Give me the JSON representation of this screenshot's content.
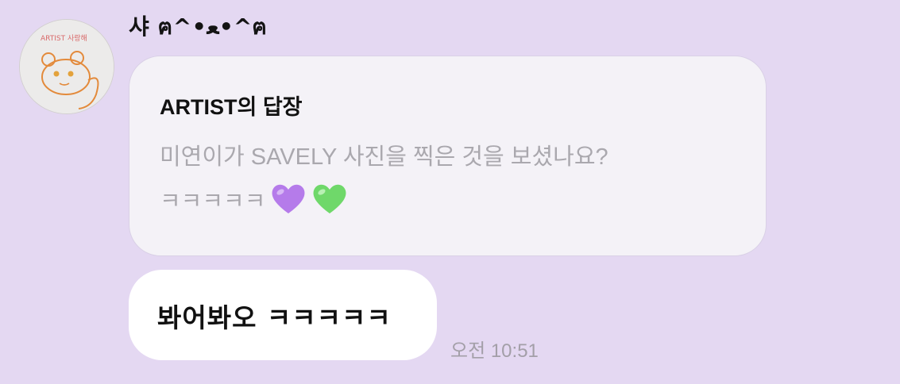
{
  "sender": {
    "name": "샤 ฅ^•ﻌ•^ฅ",
    "avatar_text": "ARTIST 사랑해"
  },
  "reply": {
    "title": "ARTIST의 답장",
    "line1": "미연이가 SAVELY 사진을 찍은 것을 보셨나요?",
    "line2": "ㅋㅋㅋㅋㅋ",
    "emojis": [
      "purple-heart",
      "green-heart"
    ]
  },
  "message": {
    "text": "봐어봐오 ㅋㅋㅋㅋㅋ",
    "time": "오전 10:51"
  },
  "colors": {
    "background": "#e4d8f2",
    "reply_bubble": "#f4f2f7",
    "message_bubble": "#ffffff",
    "muted_text": "#aaa8ae",
    "purple_heart": "#b57bea",
    "green_heart": "#6fd86a"
  }
}
